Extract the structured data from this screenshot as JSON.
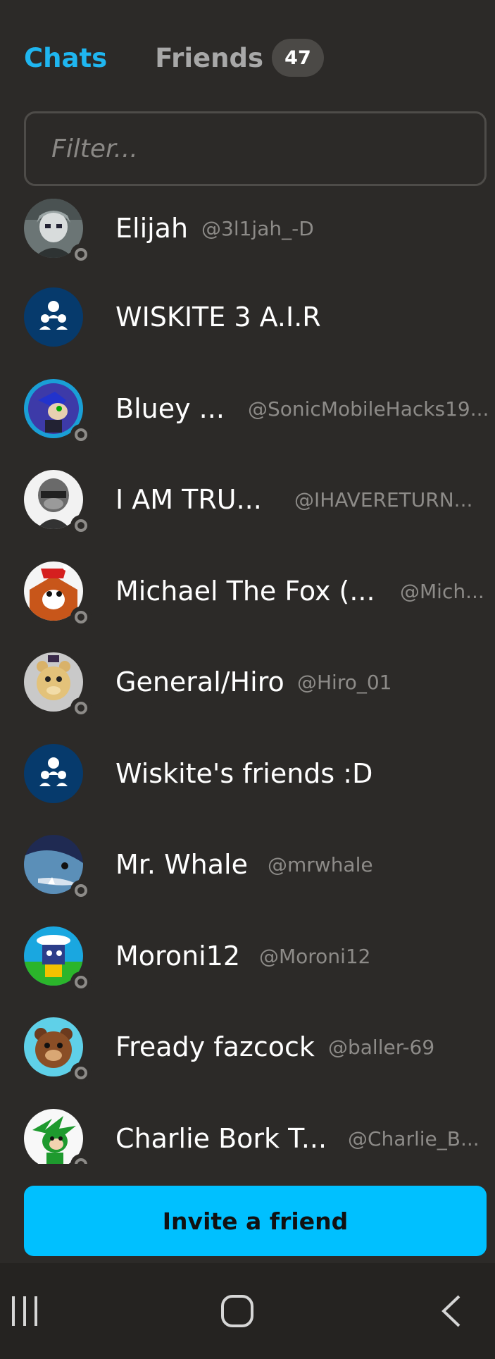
{
  "tabs": {
    "chats": "Chats",
    "friends": "Friends",
    "friends_count": "47"
  },
  "filter": {
    "placeholder": "Filter..."
  },
  "contacts": [
    {
      "name": "Elijah",
      "handle": "@3l1jah_-D",
      "avatar": "anime-avatar"
    },
    {
      "name": "WISKITE 3 A.I.R",
      "handle": "",
      "avatar": "group-icon"
    },
    {
      "name": "Bluey ...",
      "handle": "@SonicMobileHacks19...",
      "avatar": "blue-hedgehog-avatar"
    },
    {
      "name": "I AM TRU...",
      "handle": "@IHAVERETURN...",
      "avatar": "masked-avatar"
    },
    {
      "name": "Michael The Fox (...",
      "handle": "@Mich...",
      "avatar": "fox-santa-avatar"
    },
    {
      "name": "General/Hiro",
      "handle": "@Hiro_01",
      "avatar": "animatronic-bear-avatar"
    },
    {
      "name": "Wiskite's friends :D",
      "handle": "",
      "avatar": "group-icon"
    },
    {
      "name": "Mr. Whale",
      "handle": "@mrwhale",
      "avatar": "whale-avatar"
    },
    {
      "name": "Moroni12",
      "handle": "@Moroni12",
      "avatar": "green-character-avatar"
    },
    {
      "name": "Fready fazcock",
      "handle": "@baller-69",
      "avatar": "brown-bear-avatar"
    },
    {
      "name": "Charlie Bork T...",
      "handle": "@Charlie_B...",
      "avatar": "green-hedgehog-avatar"
    }
  ],
  "invite_button": "Invite a friend",
  "colors": {
    "background": "#2c2a28",
    "accent": "#1fb6f0",
    "invite_button": "#00c0ff",
    "group_avatar": "#063a6c"
  },
  "navbar": {
    "icons": [
      "recent-apps-icon",
      "home-icon",
      "back-icon"
    ]
  }
}
